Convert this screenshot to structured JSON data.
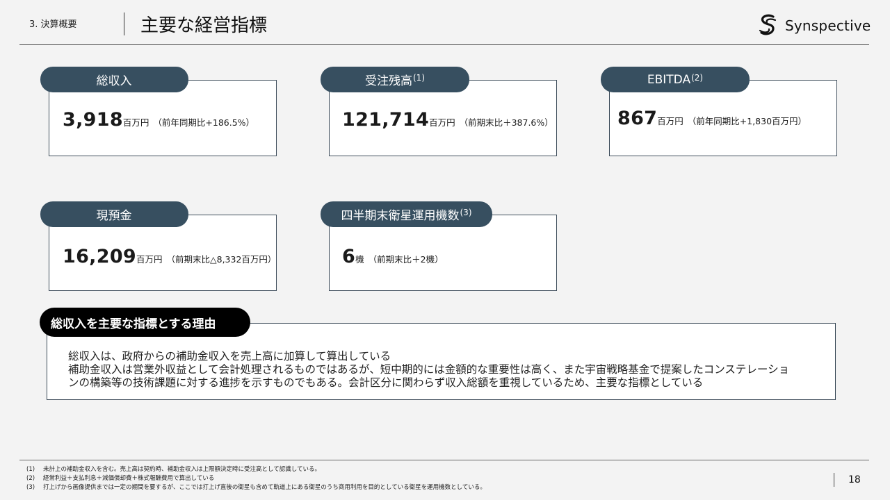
{
  "header": {
    "section": "3. 決算概要",
    "title": "主要な経営指標",
    "logo_text": "Synspective"
  },
  "cards": [
    {
      "label": "総収入",
      "sup": "",
      "value": "3,918",
      "unit": "百万円",
      "note": "（前年同期比+186.5%）"
    },
    {
      "label": "受注残高",
      "sup": "(1)",
      "value": "121,714",
      "unit": "百万円",
      "note": "（前期末比＋387.6%）"
    },
    {
      "label": "EBITDA ",
      "sup": "(2)",
      "value": "867",
      "unit": "百万円",
      "note": "（前年同期比+1,830百万円）"
    },
    {
      "label": "現預金",
      "sup": "",
      "value": "16,209",
      "unit": "百万円",
      "note": "（前期末比△8,332百万円）"
    },
    {
      "label": "四半期末衛星運用機数",
      "sup": "(3)",
      "value": "6",
      "unit": "機",
      "note": "（前期末比＋2機）"
    }
  ],
  "reason": {
    "heading": "総収入を主要な指標とする理由",
    "lines": [
      "総収入は、政府からの補助金収入を売上高に加算して算出している",
      "補助金収入は営業外収益として会計処理されるものではあるが、短中期的には金額的な重要性は高く、また宇宙戦略基金で提案したコンステレーショ",
      "ンの構築等の技術課題に対する進捗を示すものでもある。会計区分に関わらず収入総額を重視しているため、主要な指標としている"
    ]
  },
  "footnotes": [
    {
      "mark": "(1)",
      "text": "未計上の補助金収入を含む。売上高は契約時、補助金収入は上限額決定時に受注高として認識している。"
    },
    {
      "mark": "(2)",
      "text": "経常利益＋支払利息＋減価償却費＋株式報酬費用で算出している"
    },
    {
      "mark": "(3)",
      "text": "打上げから画像提供までは一定の期間を要するが、ここでは打上げ直後の衛星も含めて軌道上にある衛星のうち商用利用を目的としている衛星を運用機数としている。"
    }
  ],
  "page_number": "18",
  "colors": {
    "tab": "#374f60",
    "border": "#3d4c5a",
    "reason_tab": "#000000",
    "background": "#f3f3f3"
  }
}
